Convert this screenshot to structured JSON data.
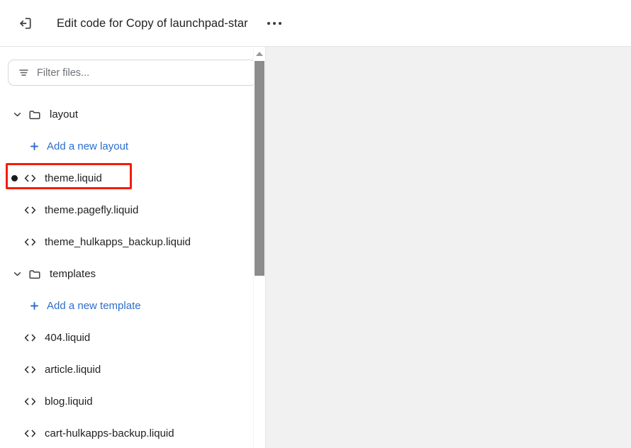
{
  "header": {
    "exit_icon": "exit-icon",
    "title": "Edit code for Copy of launchpad-star",
    "more_icon": "more-horizontal-icon"
  },
  "sidebar": {
    "filter": {
      "icon": "filter-icon",
      "value": "",
      "placeholder": "Filter files..."
    },
    "scrollbar": {
      "up_arrow_icon": "caret-up-icon"
    },
    "tree": [
      {
        "kind": "folder",
        "name": "layout",
        "icon": "folder-icon",
        "chevron": "chevron-down-icon",
        "expanded": true
      },
      {
        "kind": "add",
        "name": "Add a new layout",
        "icon": "plus-icon"
      },
      {
        "kind": "file",
        "name": "theme.liquid",
        "icon": "code-icon",
        "unsaved": true,
        "highlighted": true
      },
      {
        "kind": "file",
        "name": "theme.pagefly.liquid",
        "icon": "code-icon",
        "unsaved": false,
        "highlighted": false
      },
      {
        "kind": "file",
        "name": "theme_hulkapps_backup.liquid",
        "icon": "code-icon",
        "unsaved": false,
        "highlighted": false
      },
      {
        "kind": "folder",
        "name": "templates",
        "icon": "folder-icon",
        "chevron": "chevron-down-icon",
        "expanded": true
      },
      {
        "kind": "add",
        "name": "Add a new template",
        "icon": "plus-icon"
      },
      {
        "kind": "file",
        "name": "404.liquid",
        "icon": "code-icon",
        "unsaved": false,
        "highlighted": false
      },
      {
        "kind": "file",
        "name": "article.liquid",
        "icon": "code-icon",
        "unsaved": false,
        "highlighted": false
      },
      {
        "kind": "file",
        "name": "blog.liquid",
        "icon": "code-icon",
        "unsaved": false,
        "highlighted": false
      },
      {
        "kind": "file",
        "name": "cart-hulkapps-backup.liquid",
        "icon": "code-icon",
        "unsaved": false,
        "highlighted": false
      }
    ]
  },
  "colors": {
    "link": "#2c6ecb",
    "text": "#202223",
    "annotation": "#f51d02",
    "panel_bg": "#f1f1f1",
    "scrollbar_thumb": "#8c8c8c"
  }
}
